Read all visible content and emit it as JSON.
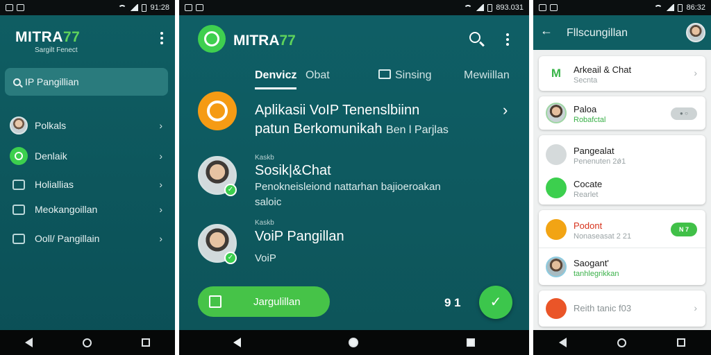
{
  "phone1": {
    "status": {
      "time": "91:28"
    },
    "brand": {
      "name_a": "MITRA",
      "name_b": "77",
      "subtitle": "Sargilt Fenect"
    },
    "search": {
      "label": "IP Pangillian"
    },
    "menu": [
      {
        "label": "Polkals",
        "icon": "avatar"
      },
      {
        "label": "Denlaik",
        "icon": "whatsapp-icon"
      },
      {
        "label": "Holiallias",
        "icon": "message-square-icon"
      },
      {
        "label": "Meokangoillan",
        "icon": "message-square-icon"
      },
      {
        "label": "Ooll/ Pangillain",
        "icon": "message-square-icon"
      }
    ]
  },
  "phone2": {
    "status": {
      "time": "893.031"
    },
    "brand": {
      "name_a": "MITRA",
      "name_b": "77"
    },
    "tabs": [
      "Denvicz",
      "Obat",
      "Sinsing",
      "Mewiillan"
    ],
    "feature": {
      "line1": "Aplikasii VoIP Tenenslbiinn",
      "line2": "patun Berkomunikah",
      "line2b": "Ben l Parjlas"
    },
    "rows": [
      {
        "tag": "Kaskb",
        "title": "Sosik|&Chat",
        "sub1": "Penokneisleiond nattarhan bajioeroakan",
        "sub2": "saloic"
      },
      {
        "tag": "Kaskb",
        "title": "VoiP Pangillan",
        "sub1": "VoiP"
      }
    ],
    "button": {
      "label": "Jargulillan"
    },
    "counter": "9 1",
    "fab": "✓"
  },
  "phone3": {
    "status": {
      "time": "86:32"
    },
    "header": {
      "title": "Fllscungillan"
    },
    "items": [
      {
        "title": "Arkeail & Chat",
        "sub": "Secnta",
        "icon": "m-icon",
        "color": "#3ab54a"
      },
      {
        "title": "Paloa",
        "sub": "Robafctal",
        "icon": "avatar",
        "toggle": "● ○"
      },
      {
        "title": "Pangealat",
        "sub": "Penenuten 2ǿ1",
        "icon": "message-square-icon",
        "color": "#d5dadb"
      },
      {
        "title": "Cocate",
        "sub": "Rearlet",
        "icon": "whatsapp-icon",
        "color": "#3ccf4e"
      },
      {
        "title": "Podont",
        "sub": "Nonaseasat 2 21",
        "icon": "chat-icon",
        "color": "#f2a414",
        "badge": "N 7"
      },
      {
        "title": "Saogant'",
        "sub": "tanhlegrikkan",
        "icon": "avatar"
      },
      {
        "title": "Reith tanic f03",
        "icon": "shield-icon",
        "color": "#ea5528"
      }
    ]
  }
}
